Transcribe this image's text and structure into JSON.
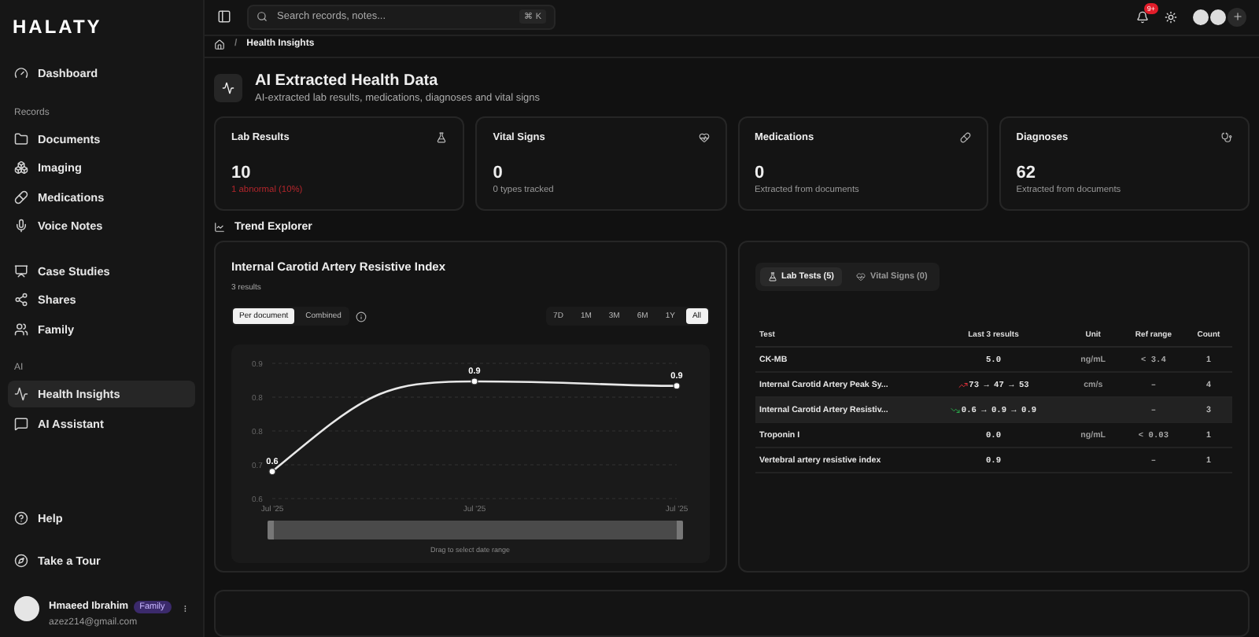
{
  "brand": "HALATY",
  "sidebar": {
    "groups": [
      {
        "items": [
          {
            "label": "Dashboard",
            "selected": false
          }
        ]
      },
      {
        "heading": "Records",
        "items": [
          {
            "label": "Documents",
            "selected": false
          },
          {
            "label": "Imaging",
            "selected": false
          },
          {
            "label": "Medications",
            "selected": false
          },
          {
            "label": "Voice Notes",
            "selected": false
          }
        ]
      },
      {
        "items": [
          {
            "label": "Case Studies",
            "selected": false
          },
          {
            "label": "Shares",
            "selected": false
          },
          {
            "label": "Family",
            "selected": false
          }
        ]
      },
      {
        "heading": "AI",
        "items": [
          {
            "label": "Health Insights",
            "selected": true
          },
          {
            "label": "AI Assistant",
            "selected": false
          }
        ]
      }
    ],
    "footer": [
      {
        "label": "Help"
      },
      {
        "label": "Take a Tour"
      }
    ],
    "user": {
      "name": "Hmaeed Ibrahim",
      "badge": "Family",
      "email": "azez214@gmail.com"
    }
  },
  "topbar": {
    "search": {
      "placeholder": "Search records, notes...",
      "shortcut": "⌘ K"
    },
    "notifications": "9+"
  },
  "breadcrumb": {
    "separator": "/",
    "items": [
      "Health Insights"
    ]
  },
  "header": {
    "title": "AI Extracted Health Data",
    "subtitle": "AI-extracted lab results, medications, diagnoses and vital signs"
  },
  "stats": [
    {
      "label": "Lab Results",
      "value": "10",
      "note": "1 abnormal (10%)",
      "alert": true
    },
    {
      "label": "Vital Signs",
      "value": "0",
      "note": "0 types tracked",
      "alert": false
    },
    {
      "label": "Medications",
      "value": "0",
      "note": "Extracted from documents",
      "alert": false
    },
    {
      "label": "Diagnoses",
      "value": "62",
      "note": "Extracted from documents",
      "alert": false
    }
  ],
  "trend": {
    "heading": "Trend Explorer",
    "title": "Internal Carotid Artery Resistive Index",
    "count": "3 results",
    "modes": [
      {
        "label": "Per document",
        "selected": true
      },
      {
        "label": "Combined",
        "selected": false
      }
    ],
    "ranges": [
      {
        "label": "7D",
        "selected": false
      },
      {
        "label": "1M",
        "selected": false
      },
      {
        "label": "3M",
        "selected": false
      },
      {
        "label": "6M",
        "selected": false
      },
      {
        "label": "1Y",
        "selected": false
      },
      {
        "label": "All",
        "selected": true
      }
    ],
    "chart_data": {
      "type": "line",
      "grid": true,
      "categories": [
        "Jul '25",
        "Jul '25",
        "Jul '25"
      ],
      "series": [
        {
          "color": "#e8e8e8",
          "marker": "circle",
          "values": [
            0.66,
            0.86,
            0.85
          ]
        }
      ],
      "ylim": [
        0.6,
        0.9
      ],
      "yticks": [
        {
          "value": 0.6,
          "label": "0.6"
        },
        {
          "value": 0.675,
          "label": "0.7"
        },
        {
          "value": 0.75,
          "label": "0.8"
        },
        {
          "value": 0.825,
          "label": "0.8"
        },
        {
          "value": 0.9,
          "label": "0.9"
        }
      ],
      "value_labels": [
        "0.6",
        "0.9",
        "0.9"
      ]
    },
    "slider": {
      "level": 1
    },
    "hint": "Drag to select date range"
  },
  "results": {
    "tabs": [
      {
        "label": "Lab Tests (5)",
        "selected": true
      },
      {
        "label": "Vital Signs (0)",
        "selected": false
      }
    ],
    "columns": [
      "Test",
      "Last 3 results",
      "Unit",
      "Ref range",
      "Count"
    ],
    "rows": [
      {
        "kind": "plain",
        "test": "CK-MB",
        "results": "5.0",
        "unit": "ng/mL",
        "ref": "< 3.4",
        "count": "1",
        "selected": false
      },
      {
        "kind": "rising",
        "test": "Internal Carotid Artery Peak Sy...",
        "results": "73 → 47 → 53",
        "unit": "cm/s",
        "ref": "–",
        "count": "4",
        "selected": false
      },
      {
        "kind": "falling",
        "test": "Internal Carotid Artery Resistiv...",
        "results": "0.6 → 0.9 → 0.9",
        "unit": "",
        "ref": "–",
        "count": "3",
        "selected": true
      },
      {
        "kind": "plain",
        "test": "Troponin I",
        "results": "0.0",
        "unit": "ng/mL",
        "ref": "< 0.03",
        "count": "1",
        "selected": false
      },
      {
        "kind": "plain",
        "test": "Vertebral artery resistive index",
        "results": "0.9",
        "unit": "",
        "ref": "–",
        "count": "1",
        "selected": false
      }
    ]
  }
}
